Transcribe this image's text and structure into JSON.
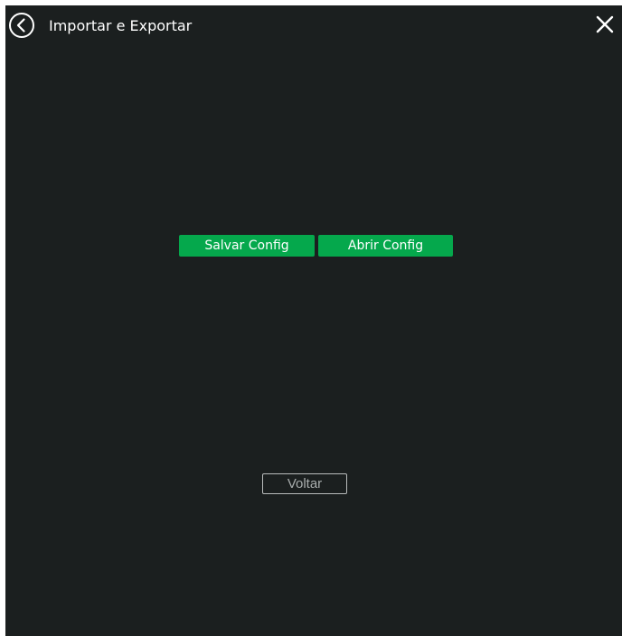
{
  "dialog": {
    "title": "Importar e Exportar",
    "back_icon": "circle-chevron-left-icon",
    "close_icon": "close-x-icon"
  },
  "actions": {
    "save_label": "Salvar Config",
    "open_label": "Abrir Config",
    "back_label": "Voltar"
  },
  "colors": {
    "background": "#1b1f1f",
    "accent_green": "#05a84c",
    "text": "#ffffff"
  }
}
